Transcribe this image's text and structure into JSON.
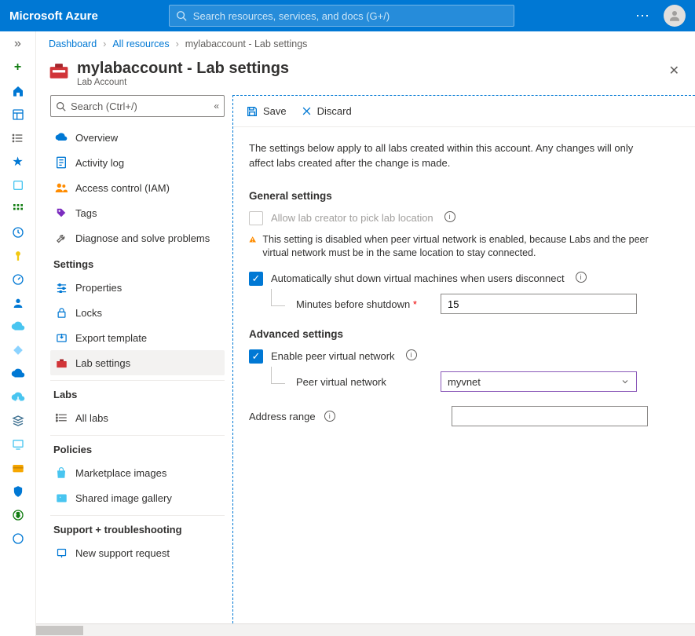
{
  "brand": "Microsoft Azure",
  "search_placeholder": "Search resources, services, and docs (G+/)",
  "breadcrumbs": {
    "dashboard": "Dashboard",
    "allres": "All resources",
    "current": "mylabaccount - Lab settings"
  },
  "page": {
    "title": "mylabaccount - Lab settings",
    "subtitle": "Lab Account"
  },
  "menu_search_placeholder": "Search (Ctrl+/)",
  "menu": {
    "overview": "Overview",
    "activity": "Activity log",
    "iam": "Access control (IAM)",
    "tags": "Tags",
    "diag": "Diagnose and solve problems",
    "g_settings": "Settings",
    "properties": "Properties",
    "locks": "Locks",
    "export": "Export template",
    "labsettings": "Lab settings",
    "g_labs": "Labs",
    "alllabs": "All labs",
    "g_policies": "Policies",
    "market": "Marketplace images",
    "shared": "Shared image gallery",
    "g_support": "Support + troubleshooting",
    "newreq": "New support request"
  },
  "toolbar": {
    "save": "Save",
    "discard": "Discard"
  },
  "form": {
    "description": "The settings below apply to all labs created within this account. Any changes will only affect labs created after the change is made.",
    "general_heading": "General settings",
    "allow_location": "Allow lab creator to pick lab location",
    "warning": "This setting is disabled when peer virtual network is enabled, because Labs and the peer virtual network must be in the same location to stay connected.",
    "auto_shutdown": "Automatically shut down virtual machines when users disconnect",
    "minutes_label": "Minutes before shutdown",
    "minutes_value": "15",
    "advanced_heading": "Advanced settings",
    "enable_peer": "Enable peer virtual network",
    "peer_label": "Peer virtual network",
    "peer_value": "myvnet",
    "address_label": "Address range"
  }
}
